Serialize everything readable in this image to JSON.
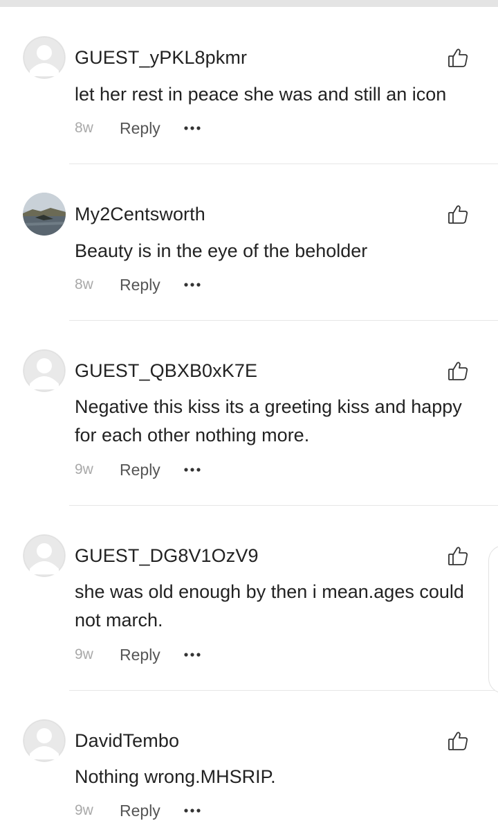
{
  "colors": {
    "text": "#222222",
    "meta": "#a9a9a9",
    "reply": "#555555",
    "divider": "#e6e6e6",
    "avatar_placeholder_bg": "#e9e9e9",
    "avatar_placeholder_fg": "#ffffff"
  },
  "comments": [
    {
      "username": "GUEST_yPKL8pkmr",
      "text": "let her rest in peace  she was and still an icon",
      "time": "8w",
      "reply_label": "Reply",
      "avatar": "default-avatar-icon",
      "like_icon": "thumbs-up-icon",
      "more_icon": "more-dots-icon"
    },
    {
      "username": "My2Centsworth",
      "text": "Beauty is in the eye of the beholder",
      "time": "8w",
      "reply_label": "Reply",
      "avatar": "landscape-photo-avatar",
      "like_icon": "thumbs-up-icon",
      "more_icon": "more-dots-icon"
    },
    {
      "username": "GUEST_QBXB0xK7E",
      "text": "Negative this kiss its a greeting kiss and happy for each other nothing more.",
      "time": "9w",
      "reply_label": "Reply",
      "avatar": "default-avatar-icon",
      "like_icon": "thumbs-up-icon",
      "more_icon": "more-dots-icon"
    },
    {
      "username": "GUEST_DG8V1OzV9",
      "text": "she was old enough by then i mean.ages could not march.",
      "time": "9w",
      "reply_label": "Reply",
      "avatar": "default-avatar-icon",
      "like_icon": "thumbs-up-icon",
      "more_icon": "more-dots-icon"
    },
    {
      "username": "DavidTembo",
      "text": "Nothing wrong.MHSRIP.",
      "time": "9w",
      "reply_label": "Reply",
      "avatar": "default-avatar-icon",
      "like_icon": "thumbs-up-icon",
      "more_icon": "more-dots-icon"
    }
  ]
}
